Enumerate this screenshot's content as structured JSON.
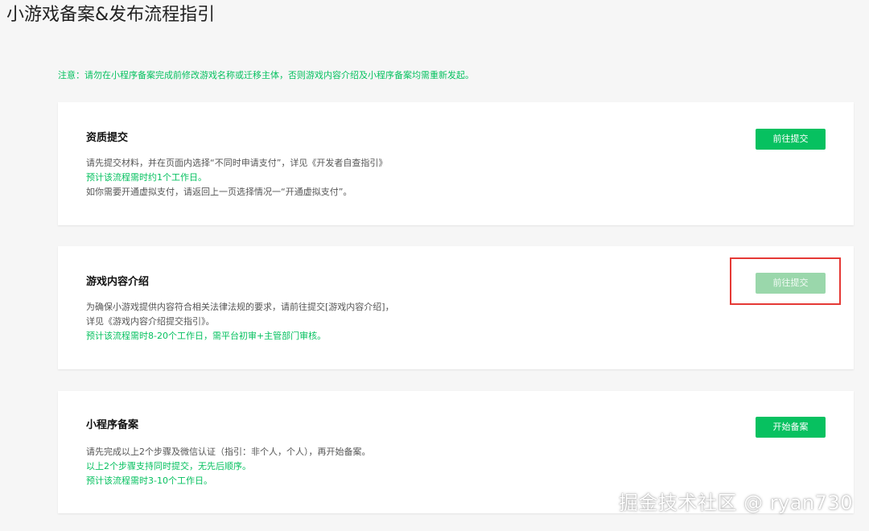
{
  "page_title": "小游戏备案&发布流程指引",
  "notice": "注意：请勿在小程序备案完成前修改游戏名称或迁移主体，否则游戏内容介绍及小程序备案均需重新发起。",
  "cards": [
    {
      "title": "资质提交",
      "lines": [
        {
          "text": "请先提交材料，并在页面内选择“不同时申请支付”，详见《开发者自查指引》",
          "color": "gray"
        },
        {
          "text": "预计该流程需时约1个工作日。",
          "color": "green"
        },
        {
          "text": "如你需要开通虚拟支付，请返回上一页选择情况一“开通虚拟支付”。",
          "color": "gray"
        }
      ],
      "button_label": "前往提交",
      "button_disabled": false
    },
    {
      "title": "游戏内容介绍",
      "lines": [
        {
          "text": "为确保小游戏提供内容符合相关法律法规的要求，请前往提交[游戏内容介绍]，",
          "color": "gray"
        },
        {
          "text": "详见《游戏内容介绍提交指引》。",
          "color": "gray"
        },
        {
          "text": "预计该流程需时8-20个工作日，需平台初审+主管部门审核。",
          "color": "green"
        }
      ],
      "button_label": "前往提交",
      "button_disabled": true
    },
    {
      "title": "小程序备案",
      "lines": [
        {
          "text": "请先完成以上2个步骤及微信认证（指引：非个人，个人），再开始备案。",
          "color": "gray"
        },
        {
          "text": "以上2个步骤支持同时提交，无先后顺序。",
          "color": "green"
        },
        {
          "text": "预计该流程需时3-10个工作日。",
          "color": "green"
        }
      ],
      "button_label": "开始备案",
      "button_disabled": false
    }
  ],
  "watermark": "掘金技术社区 @ ryan730",
  "colors": {
    "accent": "#07c160",
    "accent_disabled": "#9ad7ab",
    "highlight": "#e53935",
    "background": "#f6f6f6"
  }
}
